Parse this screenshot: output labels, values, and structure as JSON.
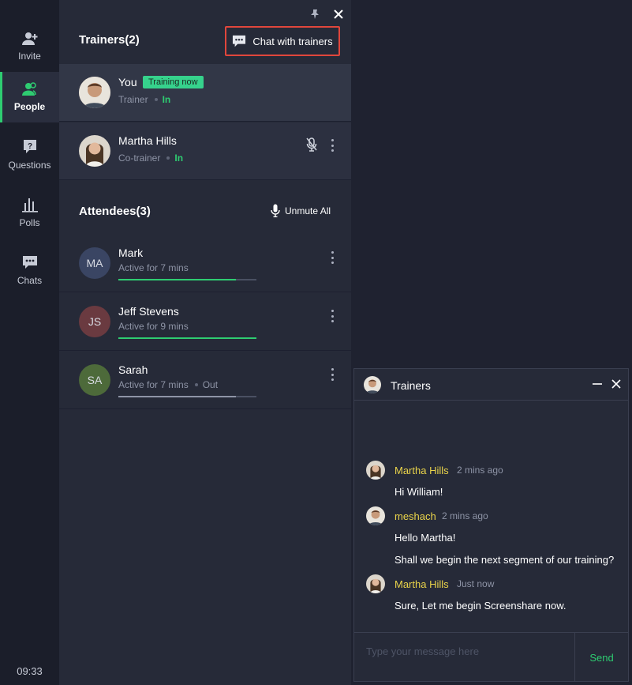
{
  "rail": {
    "items": [
      {
        "label": "Invite",
        "icon": "add-user-icon"
      },
      {
        "label": "People",
        "icon": "people-icon",
        "active": true
      },
      {
        "label": "Questions",
        "icon": "question-icon"
      },
      {
        "label": "Polls",
        "icon": "polls-icon"
      },
      {
        "label": "Chats",
        "icon": "chat-icon"
      }
    ],
    "time": "09:33"
  },
  "trainers": {
    "title": "Trainers(2)",
    "chat_button": "Chat with trainers",
    "list": [
      {
        "name": "You",
        "badge": "Training now",
        "role": "Trainer",
        "status": "In"
      },
      {
        "name": "Martha Hills",
        "role": "Co-trainer",
        "status": "In"
      }
    ]
  },
  "attendees": {
    "title": "Attendees(3)",
    "unmute_all": "Unmute All",
    "list": [
      {
        "initials": "MA",
        "name": "Mark",
        "activity": "Active for 7 mins",
        "status": "",
        "progress": 0.85,
        "avatar_color": "#3a4563"
      },
      {
        "initials": "JS",
        "name": "Jeff Stevens",
        "activity": "Active for 9 mins",
        "status": "",
        "progress": 1.0,
        "avatar_color": "#6a3a40"
      },
      {
        "initials": "SA",
        "name": "Sarah",
        "activity": "Active for 7 mins",
        "status": "Out",
        "progress": 0.85,
        "avatar_color": "#4d6a3a"
      }
    ]
  },
  "chat": {
    "title": "Trainers",
    "messages": [
      {
        "author": "Martha Hills",
        "time": "2 mins ago",
        "lines": [
          "Hi William!"
        ]
      },
      {
        "author": "meshach",
        "time": "2 mins ago",
        "lines": [
          "Hello Martha!",
          "Shall we begin the next segment of our training?"
        ]
      },
      {
        "author": "Martha Hills",
        "time": "Just now",
        "lines": [
          "Sure, Let me begin Screenshare now."
        ]
      }
    ],
    "placeholder": "Type your message here",
    "send": "Send"
  },
  "colors": {
    "accent": "#2ecc71",
    "highlight_border": "#e0463c",
    "author": "#e9d34a"
  }
}
